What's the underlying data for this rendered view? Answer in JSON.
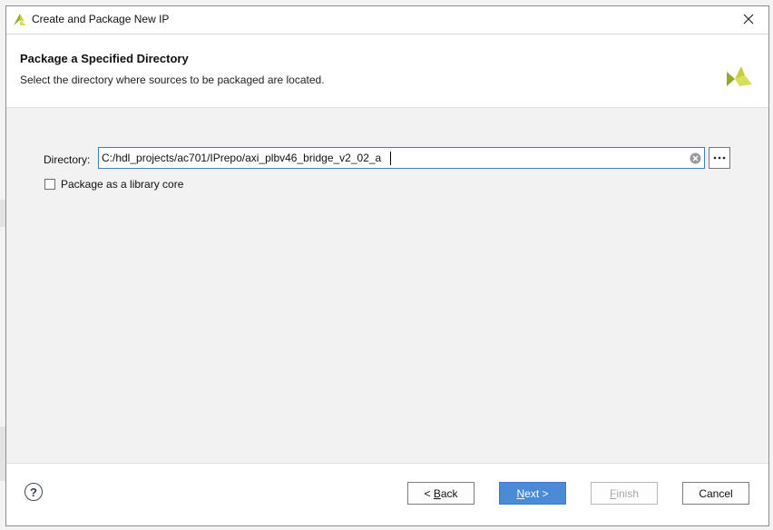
{
  "dialog": {
    "title": "Create and Package New IP",
    "header": {
      "title": "Package a Specified Directory",
      "subtitle": "Select the directory where sources to be packaged are located."
    },
    "directory": {
      "label": "Directory:",
      "value": "C:/hdl_projects/ac701/IPrepo/axi_plbv46_bridge_v2_02_a",
      "browse_label": "..."
    },
    "library_core": {
      "label": "Package as a library core",
      "checked": false
    },
    "buttons": {
      "help": "?",
      "back_prefix": "< ",
      "back_mnemonic": "B",
      "back_rest": "ack",
      "next_mnemonic": "N",
      "next_rest": "ext >",
      "finish_mnemonic": "F",
      "finish_rest": "inish",
      "cancel": "Cancel"
    }
  },
  "colors": {
    "accent": "#4a8ad6",
    "logo_green": "#9aa828",
    "logo_yellow": "#d7e05a"
  },
  "icons": [
    "vivado-logo-icon",
    "close-icon",
    "clear-icon",
    "ellipsis-icon",
    "help-icon"
  ]
}
